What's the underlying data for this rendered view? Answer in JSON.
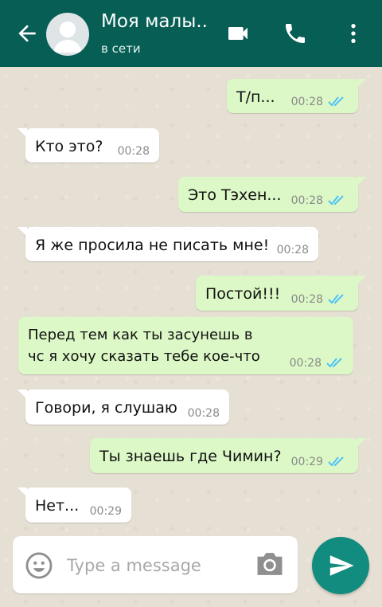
{
  "header": {
    "contact_name": "Моя малы..",
    "status": "в сети",
    "back_icon": "arrow-left-icon",
    "video_icon": "video-call-icon",
    "call_icon": "phone-icon",
    "menu_icon": "more-vert-icon",
    "color": "#075e54"
  },
  "messages": [
    {
      "direction": "out",
      "text": "Т/п...",
      "time": "00:28",
      "status": "read"
    },
    {
      "direction": "in",
      "text": "Кто это?",
      "time": "00:28"
    },
    {
      "direction": "out",
      "text": "Это Тэхен...",
      "time": "00:28",
      "status": "read"
    },
    {
      "direction": "in",
      "text": "Я же просила не писать мне!",
      "time": "00:28"
    },
    {
      "direction": "out",
      "text": "Постой!!!",
      "time": "00:28",
      "status": "read"
    },
    {
      "direction": "out",
      "text": "Перед тем как ты засунешь в\nчс я хочу сказать тебе кое-что",
      "time": "00:28",
      "status": "read"
    },
    {
      "direction": "in",
      "text": "Говори, я слушаю",
      "time": "00:28"
    },
    {
      "direction": "out",
      "text": "Ты знаешь где Чимин?",
      "time": "00:29",
      "status": "read"
    },
    {
      "direction": "in",
      "text": "Нет...",
      "time": "00:29"
    }
  ],
  "composer": {
    "placeholder": "Type a message",
    "emoji_icon": "emoji-icon",
    "camera_icon": "camera-icon",
    "send_icon": "send-icon",
    "send_color": "#128c7e"
  },
  "colors": {
    "outgoing_bubble": "#dcf8c6",
    "incoming_bubble": "#ffffff",
    "read_ticks": "#4fc3f7",
    "chat_background": "#e6dfd4"
  }
}
